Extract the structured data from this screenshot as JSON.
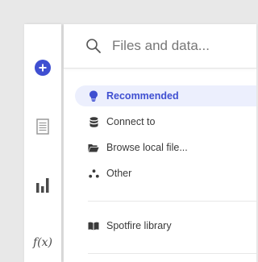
{
  "search": {
    "placeholder": "Files and data..."
  },
  "rail": {
    "items": [
      {
        "icon": "add-icon",
        "color": "#3f4fd1"
      },
      {
        "icon": "document-icon"
      },
      {
        "icon": "bar-chart-icon"
      },
      {
        "icon": "function-icon",
        "label": "f(x)"
      }
    ]
  },
  "nav": {
    "items": [
      {
        "label": "Recommended",
        "icon": "lightbulb-icon",
        "active": true
      },
      {
        "label": "Connect to",
        "icon": "database-icon"
      },
      {
        "label": "Browse local file...",
        "icon": "folder-open-icon"
      },
      {
        "label": "Other",
        "icon": "dots-icon"
      },
      {
        "label": "Spotfire library",
        "icon": "book-icon"
      }
    ]
  },
  "colors": {
    "accent": "#3f4fd1",
    "active_bg": "#eceffd"
  }
}
